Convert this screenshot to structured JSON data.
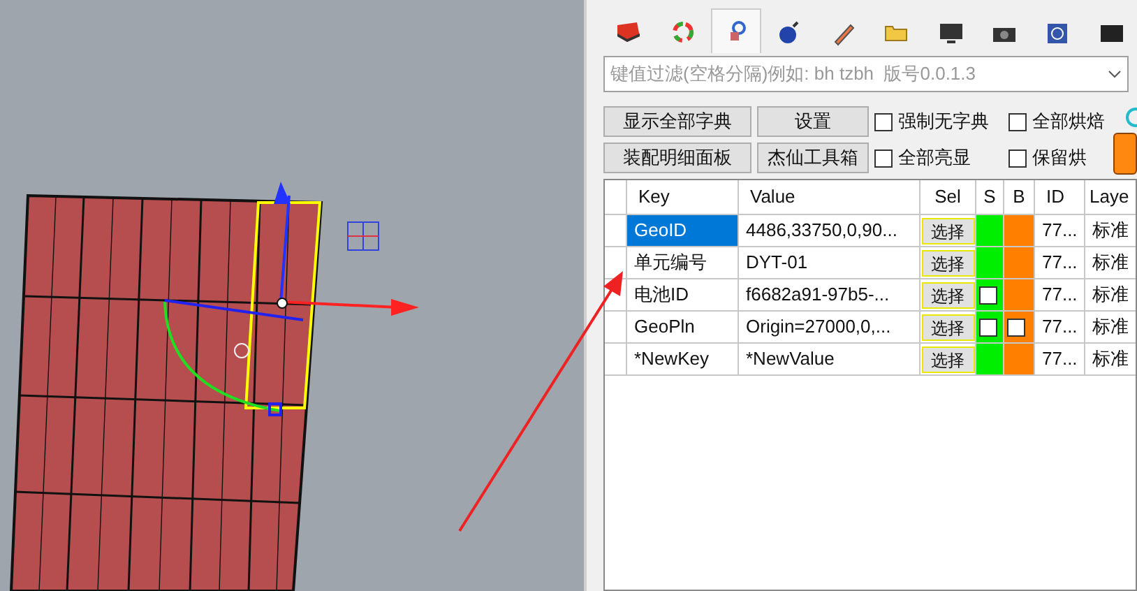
{
  "tabs": [
    {
      "selected": false
    },
    {
      "selected": false
    },
    {
      "selected": true
    },
    {
      "selected": false
    },
    {
      "selected": false
    },
    {
      "selected": false
    },
    {
      "selected": false
    },
    {
      "selected": false
    },
    {
      "selected": false
    },
    {
      "selected": false
    }
  ],
  "filter": {
    "placeholder": "键值过滤(空格分隔)例如: bh tzbh  版号0.0.1.3"
  },
  "buttons": [
    "显示全部字典",
    "设置",
    "装配明细面板",
    "杰仙工具箱"
  ],
  "checkboxes": [
    {
      "label": "强制无字典",
      "checked": false
    },
    {
      "label": "全部烘焙",
      "checked": false
    },
    {
      "label": "全部亮显",
      "checked": false
    },
    {
      "label": "保留烘",
      "checked": false
    }
  ],
  "table": {
    "columns": [
      "Key",
      "Value",
      "Sel",
      "S",
      "B",
      "ID",
      "Laye"
    ],
    "rows": [
      {
        "key": "GeoID",
        "value": "4486,33750,0,90...",
        "sel": "选择",
        "s": {
          "kind": "plain"
        },
        "b": {
          "kind": "plain"
        },
        "id": "77...",
        "layer": "标准",
        "selected": true
      },
      {
        "key": "单元编号",
        "value": "DYT-01",
        "sel": "选择",
        "s": {
          "kind": "plain"
        },
        "b": {
          "kind": "plain"
        },
        "id": "77...",
        "layer": "标准",
        "selected": false
      },
      {
        "key": "电池ID",
        "value": "f6682a91-97b5-...",
        "sel": "选择",
        "s": {
          "kind": "checkbox",
          "checked": false
        },
        "b": {
          "kind": "plain"
        },
        "id": "77...",
        "layer": "标准",
        "selected": false
      },
      {
        "key": "GeoPln",
        "value": "Origin=27000,0,...",
        "sel": "选择",
        "s": {
          "kind": "checkbox",
          "checked": false
        },
        "b": {
          "kind": "checkbox",
          "checked": false
        },
        "id": "77...",
        "layer": "标准",
        "selected": false
      },
      {
        "key": "*NewKey",
        "value": "*NewValue",
        "sel": "选择",
        "s": {
          "kind": "plain"
        },
        "b": {
          "kind": "plain"
        },
        "id": "77...",
        "layer": "标准",
        "selected": false
      }
    ]
  }
}
